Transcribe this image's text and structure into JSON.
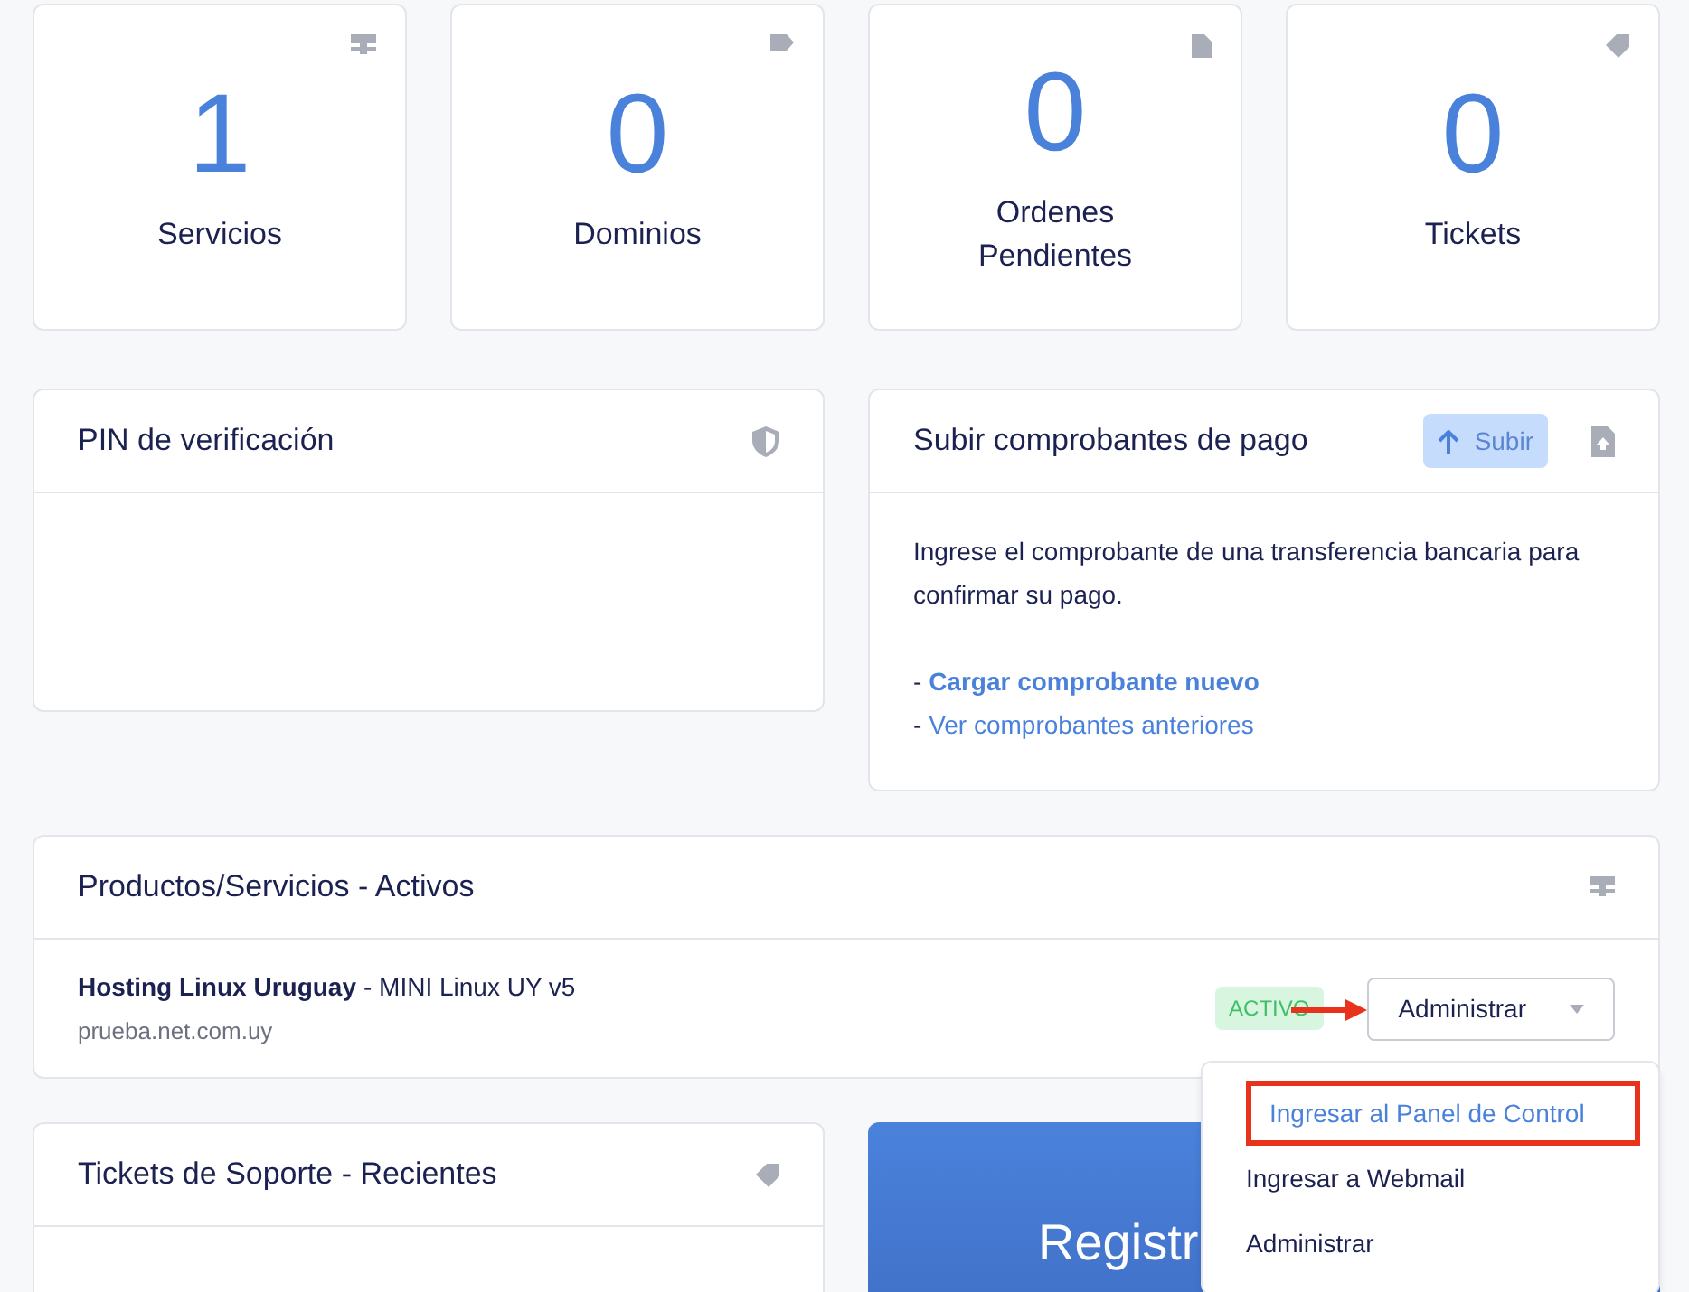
{
  "stats": [
    {
      "value": "1",
      "label": "Servicios",
      "kind": "services"
    },
    {
      "value": "0",
      "label": "Dominios",
      "kind": "domains"
    },
    {
      "value": "0",
      "label": "Ordenes Pendientes",
      "kind": "orders"
    },
    {
      "value": "0",
      "label": "Tickets",
      "kind": "tickets"
    }
  ],
  "pin_panel": {
    "title": "PIN de verificación"
  },
  "upload_panel": {
    "title": "Subir comprobantes de pago",
    "button": "Subir",
    "text": "Ingrese el comprobante de una transferencia bancaria para confirmar su pago.",
    "links": [
      {
        "prefix": "- ",
        "label": "Cargar comprobante nuevo",
        "bold": true
      },
      {
        "prefix": "- ",
        "label": "Ver comprobantes anteriores",
        "bold": false
      }
    ]
  },
  "products_panel": {
    "title": "Productos/Servicios - Activos",
    "items": [
      {
        "product": "Hosting Linux Uruguay",
        "plan": "- MINI Linux UY v5",
        "domain": "prueba.net.com.uy",
        "status": "ACTIVO",
        "action": "Administrar"
      }
    ]
  },
  "dropdown": {
    "items": [
      {
        "label": "Ingresar al Panel de Control",
        "highlighted": true
      },
      {
        "label": "Ingresar a Webmail",
        "highlighted": false
      },
      {
        "label": "Administrar",
        "highlighted": false
      }
    ]
  },
  "tickets_panel": {
    "title": "Tickets de Soporte - Recientes"
  },
  "banner": {
    "text": "Registr"
  }
}
